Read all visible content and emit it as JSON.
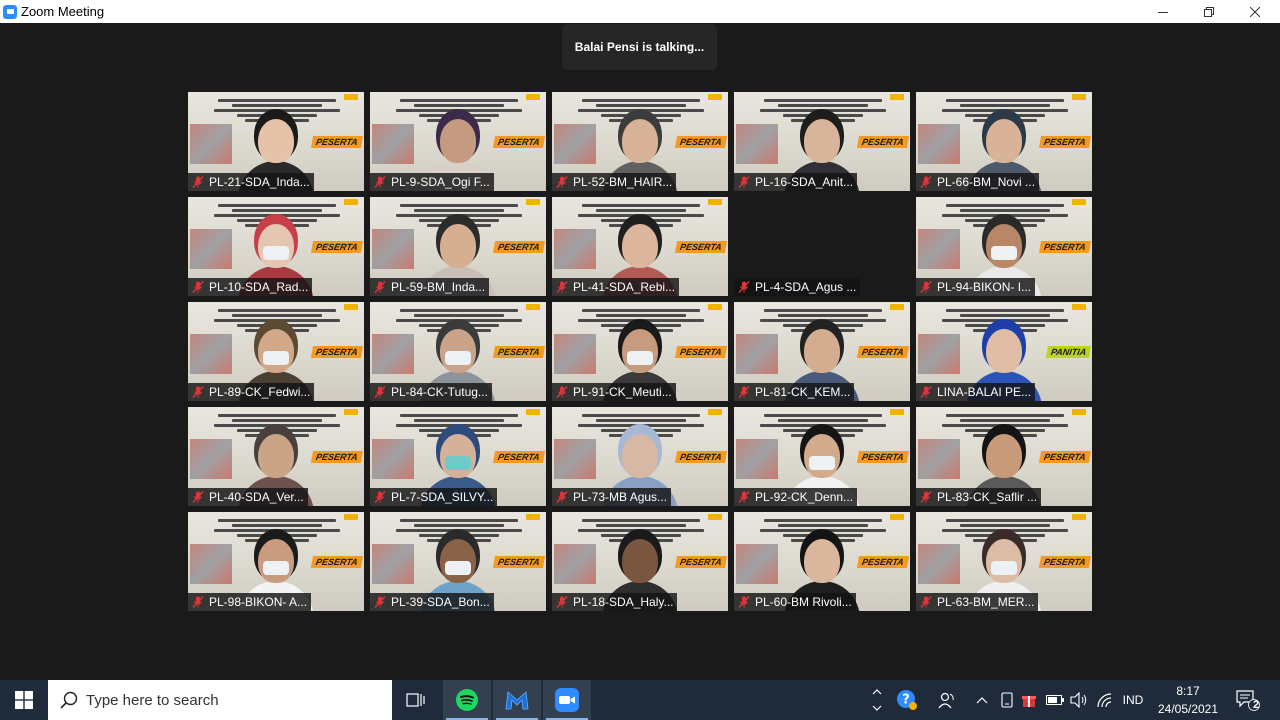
{
  "window": {
    "title": "Zoom Meeting"
  },
  "meeting": {
    "talking_indicator": "Balai Pensi is talking...",
    "participants": [
      "PL-21-SDA_Inda...",
      "PL-9-SDA_Ogi F...",
      "PL-52-BM_HAIR...",
      "PL-16-SDA_Anit...",
      "PL-66-BM_Novi ...",
      "PL-10-SDA_Rad...",
      "PL-59-BM_Inda...",
      "PL-41-SDA_Rebi...",
      "PL-4-SDA_Agus ...",
      "PL-94-BIKON- I...",
      "PL-89-CK_Fedwi...",
      "PL-84-CK-Tutug...",
      "PL-91-CK_Meuti...",
      "PL-81-CK_KEM...",
      "LINA-BALAI PE...",
      "PL-40-SDA_Ver...",
      "PL-7-SDA_SILVY...",
      "PL-73-MB Agus...",
      "PL-92-CK_Denn...",
      "PL-83-CK_Saflir ...",
      "PL-98-BIKON- A...",
      "PL-39-SDA_Bon...",
      "PL-18-SDA_Haly...",
      "PL-60-BM Rivoli...",
      "PL-63-BM_MER..."
    ],
    "tile_badges": [
      "PESERTA",
      "PANITIA"
    ]
  },
  "taskbar": {
    "search_placeholder": "Type here to search",
    "language": "IND",
    "time": "8:17",
    "date": "24/05/2021",
    "notification_count": "2"
  },
  "colors": {
    "meeting_bg": "#1a1a1a",
    "taskbar_bg": "#1f2b3a",
    "zoom_blue": "#2d8cff",
    "mute_red": "#e0343a",
    "badge_orange": "#f29b20",
    "badge_green": "#b9d51e"
  }
}
